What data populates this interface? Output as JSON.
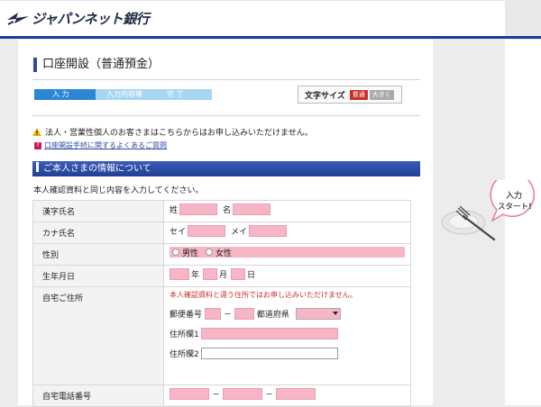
{
  "header": {
    "bank_name": "ジャパンネット銀行"
  },
  "page": {
    "title": "口座開設（普通預金）"
  },
  "steps": [
    "入 力",
    "入力内容確認",
    "完 了"
  ],
  "fontsize": {
    "label": "文字サイズ",
    "normal": "普通",
    "large": "大きく"
  },
  "notice": "法人・営業性個人のお客さまはこちらからはお申し込みいただけません。",
  "faq_link": "口座開設手続に関するよくあるご質問",
  "section": {
    "title": "ご本人さまの情報について",
    "intro": "本人確認資料と同じ内容を入力してください。"
  },
  "form": {
    "kanji_name": {
      "label": "漢字氏名",
      "sei": "姓",
      "mei": "名"
    },
    "kana_name": {
      "label": "カナ氏名",
      "sei": "セイ",
      "mei": "メイ"
    },
    "gender": {
      "label": "性別",
      "male": "男性",
      "female": "女性"
    },
    "birthdate": {
      "label": "生年月日",
      "year": "年",
      "month": "月",
      "day": "日"
    },
    "address": {
      "label": "自宅ご住所",
      "note": "本人確認資料と違う住所ではお申し込みいただけません。",
      "postal_label": "郵便番号",
      "postal_sep": "－",
      "pref_label": "都道府県",
      "addr1_label": "住所欄1",
      "addr2_label": "住所欄2"
    },
    "phone": {
      "label": "自宅電話番号",
      "sep1": "－",
      "sep2": "－"
    }
  },
  "deco": {
    "text_line1": "入力",
    "text_line2": "スタート!"
  },
  "colors": {
    "brand": "#1f3a93",
    "required_field": "#f7b6c6",
    "alert": "#c9302c"
  }
}
